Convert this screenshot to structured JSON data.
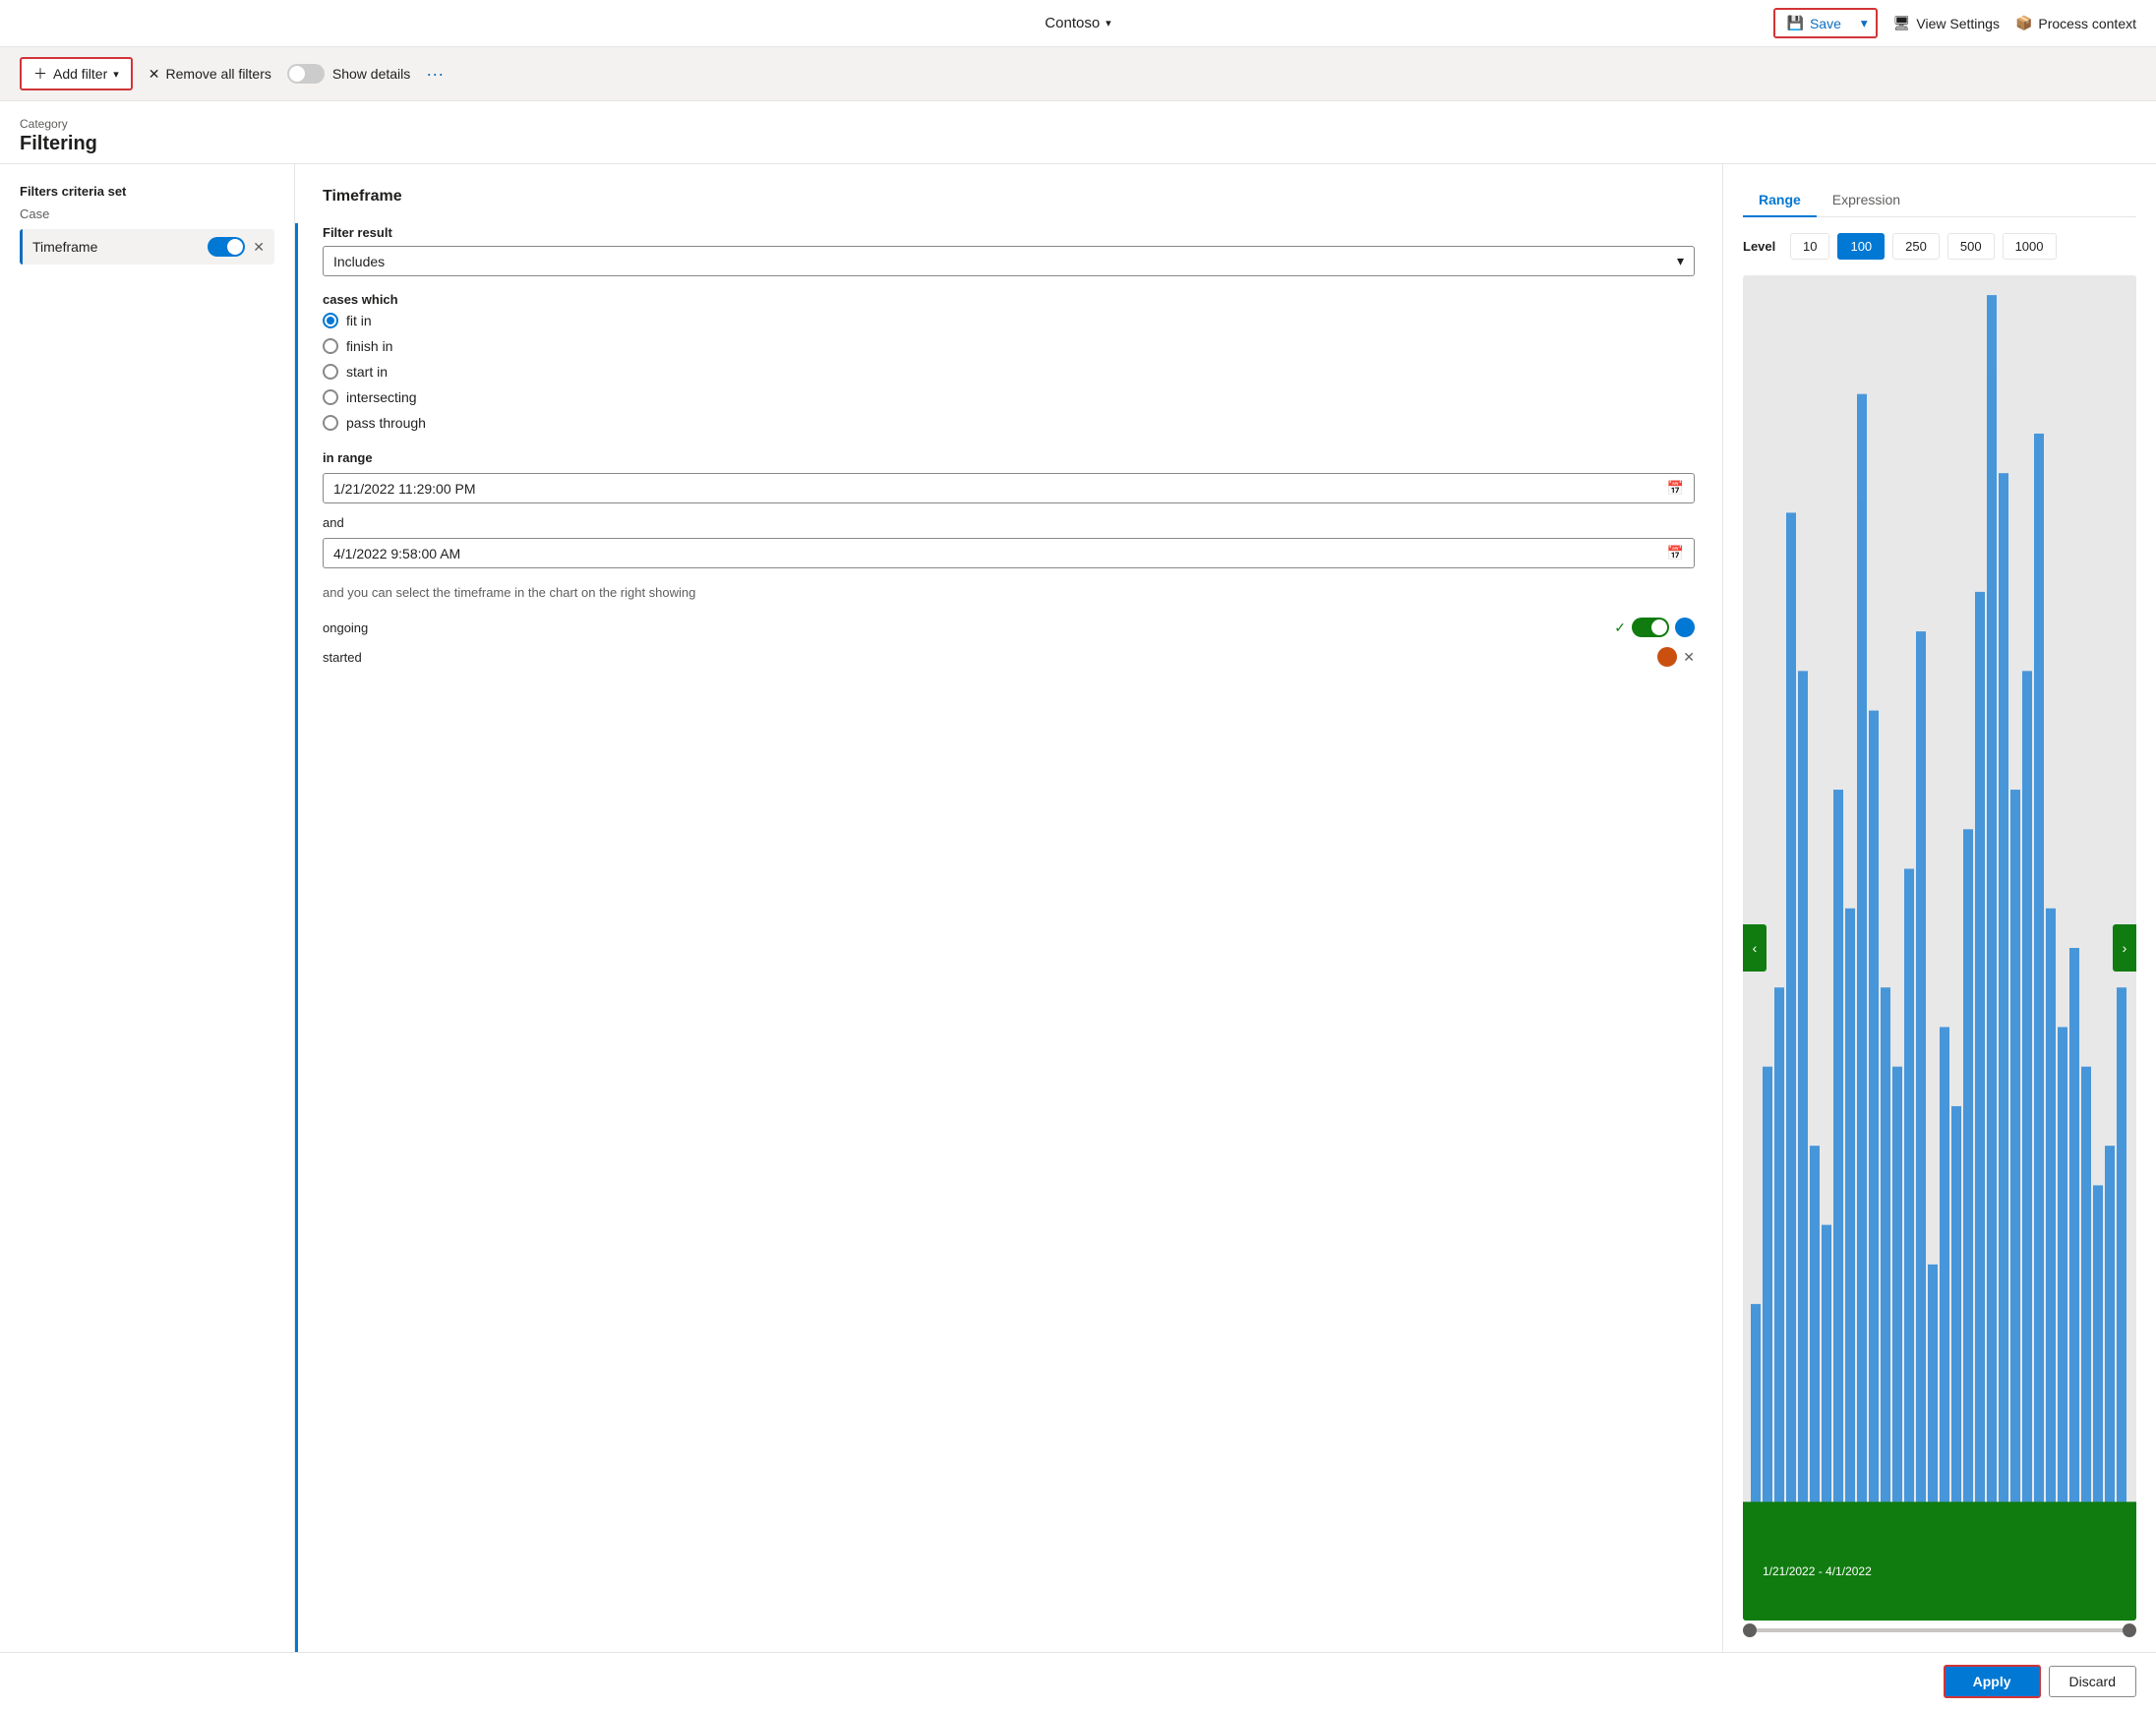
{
  "topNav": {
    "orgName": "Contoso",
    "saveLabel": "Save",
    "viewSettingsLabel": "View Settings",
    "processContextLabel": "Process context"
  },
  "filterBar": {
    "addFilterLabel": "Add filter",
    "removeAllFiltersLabel": "Remove all filters",
    "showDetailsLabel": "Show details",
    "moreIcon": "···"
  },
  "pageHeader": {
    "categoryLabel": "Category",
    "pageTitle": "Filtering"
  },
  "leftPanel": {
    "sectionTitle": "Filters criteria set",
    "caseLabel": "Case",
    "filterItem": {
      "label": "Timeframe"
    }
  },
  "middlePanel": {
    "sectionTitle": "Timeframe",
    "filterResultLabel": "Filter result",
    "filterResultValue": "Includes",
    "casesWhichLabel": "cases which",
    "radioOptions": [
      {
        "label": "fit in",
        "selected": true
      },
      {
        "label": "finish in",
        "selected": false
      },
      {
        "label": "start in",
        "selected": false
      },
      {
        "label": "intersecting",
        "selected": false
      },
      {
        "label": "pass through",
        "selected": false
      }
    ],
    "inRangeLabel": "in range",
    "startDate": "1/21/2022 11:29:00 PM",
    "andLabel": "and",
    "endDate": "4/1/2022 9:58:00 AM",
    "hintText": "and you can select the timeframe in the chart on the right showing",
    "ongoingLabel": "ongoing",
    "startedLabel": "started"
  },
  "rightPanel": {
    "tabs": [
      {
        "label": "Range",
        "active": true
      },
      {
        "label": "Expression",
        "active": false
      }
    ],
    "levelLabel": "Level",
    "levelOptions": [
      {
        "value": "10",
        "active": false
      },
      {
        "value": "100",
        "active": true
      },
      {
        "value": "250",
        "active": false
      },
      {
        "value": "500",
        "active": false
      },
      {
        "value": "1000",
        "active": false
      }
    ],
    "dateRangeLabel": "1/21/2022 - 4/1/2022"
  },
  "bottomBar": {
    "applyLabel": "Apply",
    "discardLabel": "Discard"
  }
}
